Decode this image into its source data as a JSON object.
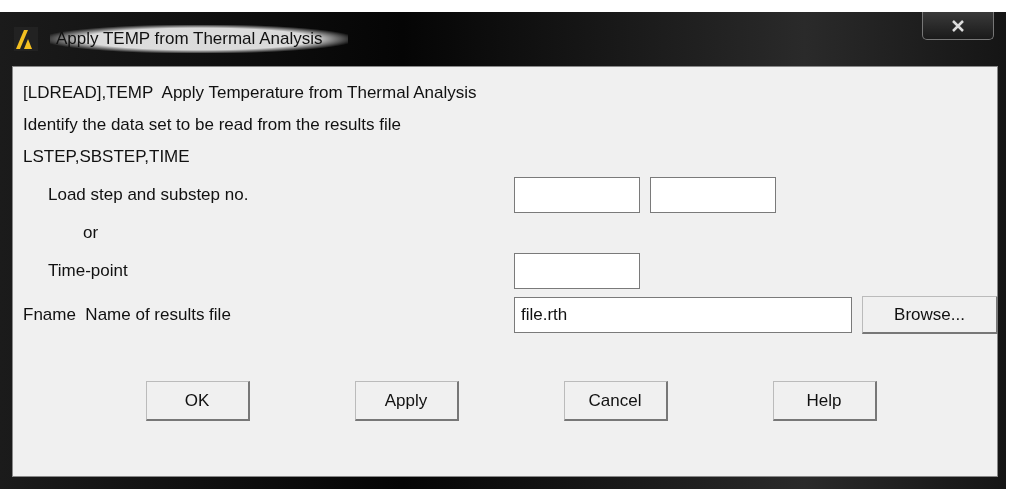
{
  "window": {
    "title": "Apply TEMP from Thermal Analysis"
  },
  "rows": [
    {
      "kind": "note",
      "label": "[LDREAD],TEMP  Apply Temperature from Thermal Analysis"
    },
    {
      "kind": "note",
      "label": "Identify the data set to be read from the results file"
    },
    {
      "kind": "section",
      "label": "LSTEP,SBSTEP,TIME",
      "children": [
        {
          "kind": "input",
          "label": "Load step and substep no.",
          "fields": [
            {
              "kind": "short"
            },
            {
              "kind": "short"
            }
          ]
        },
        {
          "kind": "note",
          "label": "or"
        },
        {
          "kind": "input",
          "label": "Time-point",
          "fields": [
            {
              "kind": "short"
            }
          ]
        }
      ]
    },
    {
      "kind": "input",
      "label": "Fname  Name of results file",
      "fields": [
        {
          "kind": "long",
          "value": "file.rth"
        }
      ],
      "button": "Browse..."
    }
  ],
  "buttons": [
    "OK",
    "Apply",
    "Cancel",
    "Help"
  ]
}
